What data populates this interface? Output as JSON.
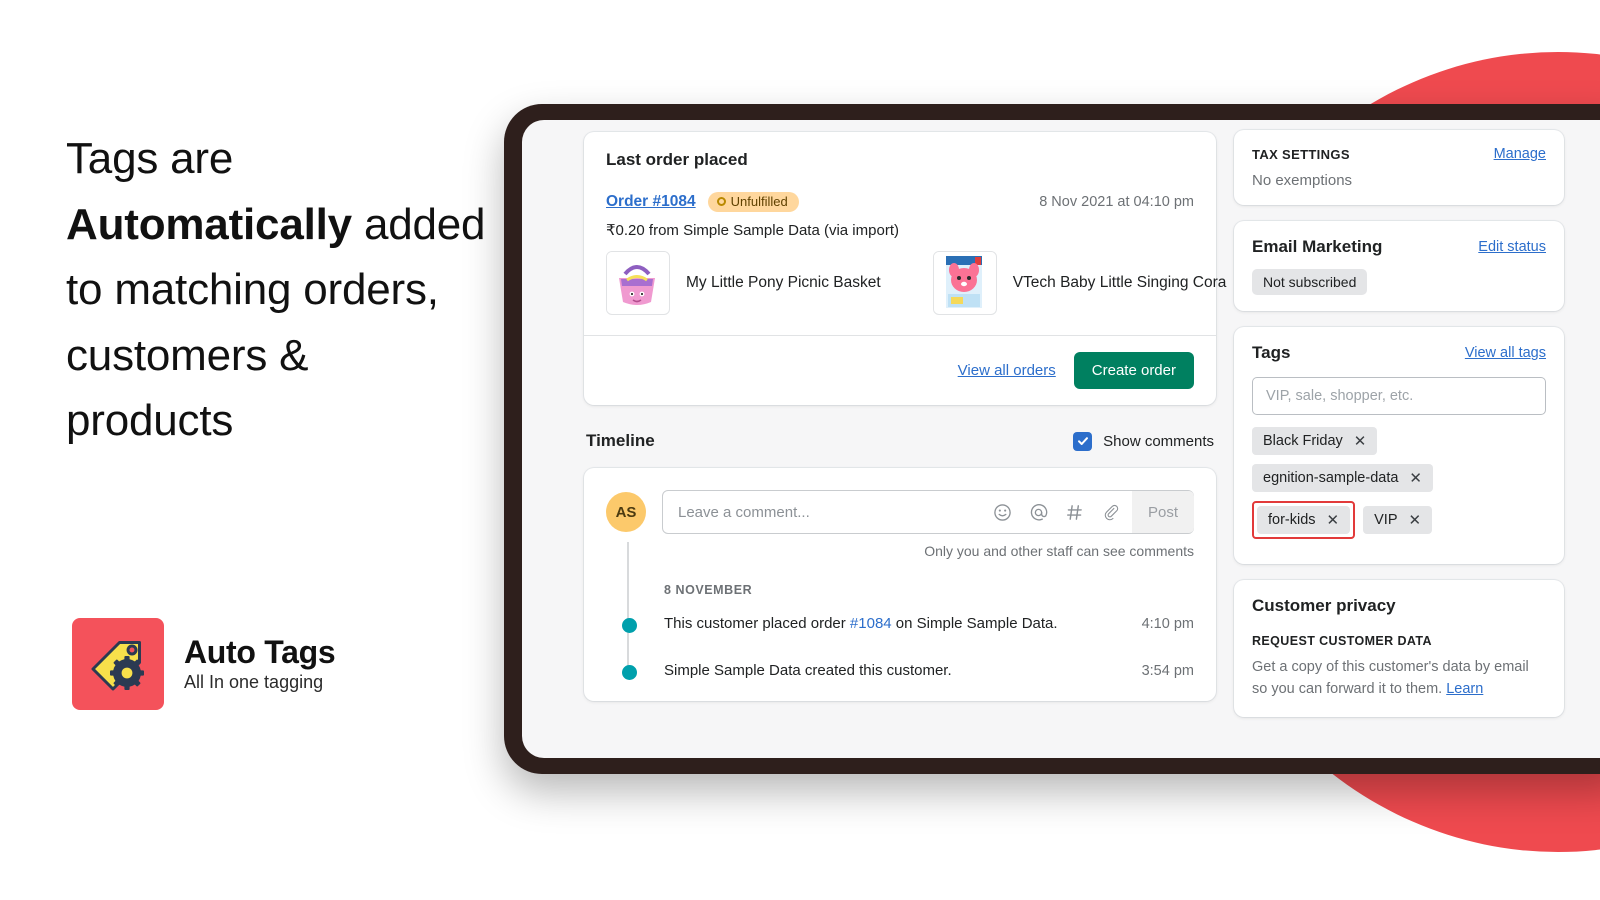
{
  "promo": {
    "line1": "Tags are ",
    "line_bold": "Automatically",
    "line2": " added to matching orders, customers & products"
  },
  "brand": {
    "name": "Auto Tags",
    "tagline": "All In one tagging",
    "logo_icon": "tag-gear-icon",
    "logo_bg": "#f4525b",
    "logo_tag_color": "#f7e04b",
    "logo_gear_color": "#2b3a52"
  },
  "decor": {
    "circle_color": "#ef4a4f",
    "bezel_color": "#2e1f1c"
  },
  "order": {
    "heading": "Last order placed",
    "order_link": "Order #1084",
    "status": "Unfulfilled",
    "date": "8 Nov 2021 at 04:10 pm",
    "subtitle": "₹0.20 from Simple Sample Data (via import)",
    "items": [
      {
        "name": "My Little Pony Picnic Basket",
        "thumb": "pony-picnic-basket-thumb"
      },
      {
        "name": "VTech Baby Little Singing Cora",
        "thumb": "vtech-singing-cora-thumb"
      }
    ],
    "view_all_orders": "View all orders",
    "create_order": "Create order"
  },
  "timeline": {
    "title": "Timeline",
    "show_comments_label": "Show comments",
    "show_comments_checked": true,
    "avatar_initials": "AS",
    "comment_placeholder": "Leave a comment...",
    "post_label": "Post",
    "privacy_note": "Only you and other staff can see comments",
    "date_group": "8 NOVEMBER",
    "events": [
      {
        "text_before": "This customer placed order ",
        "link": "#1084",
        "text_after": " on Simple Sample Data.",
        "time": "4:10 pm"
      },
      {
        "text_before": "Simple Sample Data created this customer.",
        "link": "",
        "text_after": "",
        "time": "3:54 pm"
      }
    ],
    "icons": [
      "emoji-icon",
      "mention-icon",
      "hashtag-icon",
      "attachment-icon"
    ]
  },
  "sidebar": {
    "tax": {
      "kicker": "TAX SETTINGS",
      "action": "Manage",
      "body": "No exemptions"
    },
    "email": {
      "title": "Email Marketing",
      "action": "Edit status",
      "status": "Not subscribed"
    },
    "tags": {
      "title": "Tags",
      "action": "View all tags",
      "input_placeholder": "VIP, sale, shopper, etc.",
      "items": [
        {
          "label": "Black Friday",
          "highlighted": false
        },
        {
          "label": "egnition-sample-data",
          "highlighted": false
        },
        {
          "label": "for-kids",
          "highlighted": true
        },
        {
          "label": "VIP",
          "highlighted": false
        }
      ],
      "highlight_color": "#e23a3a"
    },
    "privacy": {
      "title": "Customer privacy",
      "kicker": "REQUEST CUSTOMER DATA",
      "body": "Get a copy of this customer's data by email so you can forward it to them. ",
      "link": "Learn"
    }
  }
}
